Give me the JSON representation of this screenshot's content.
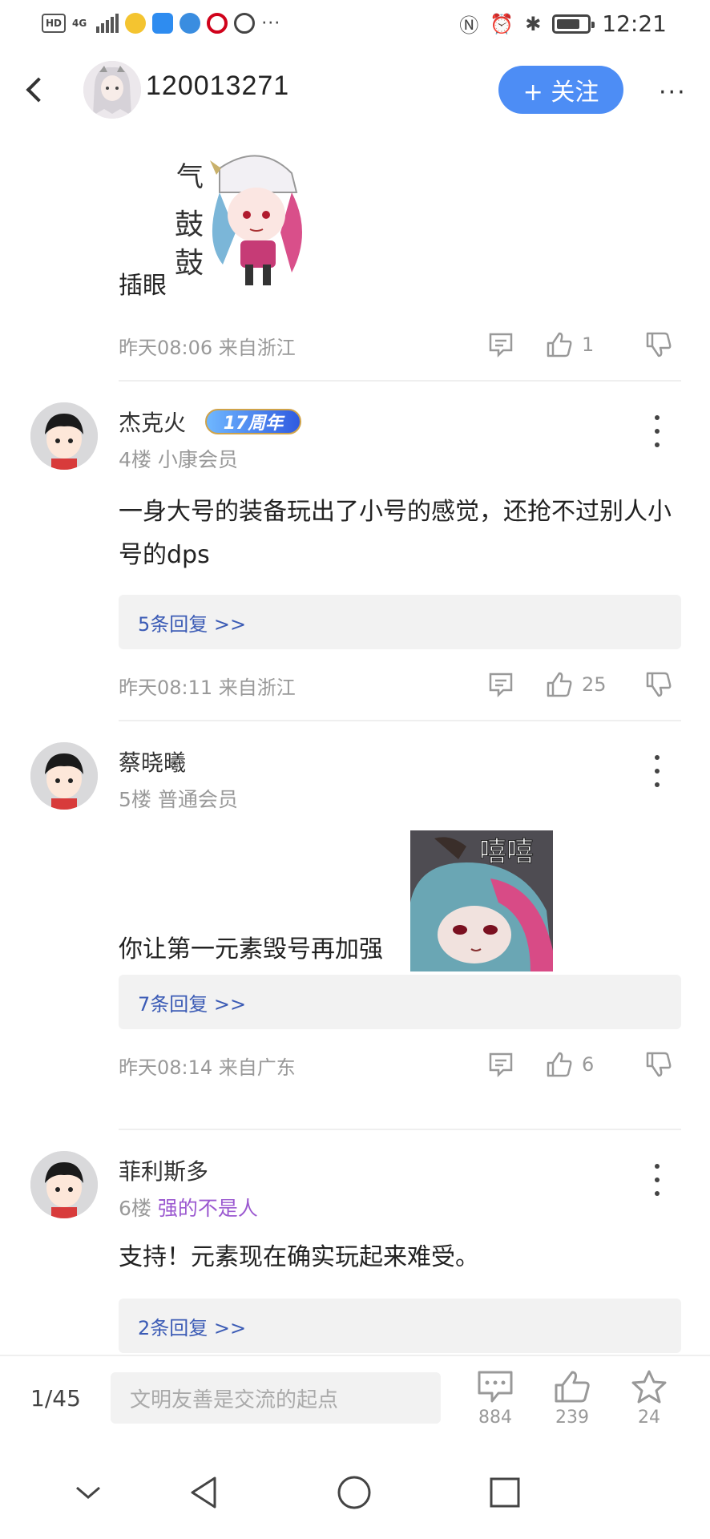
{
  "status_bar": {
    "time": "12:21",
    "hd_label": "HD",
    "network": "4G",
    "icons": [
      "weibo-icon",
      "app-icon",
      "browser-icon",
      "cmb-icon",
      "hand-icon",
      "more-icon",
      "nfc-icon",
      "alarm-icon",
      "bluetooth-icon",
      "battery-icon"
    ]
  },
  "header": {
    "title": "120013271",
    "follow_label": "+ 关注",
    "more_label": "···",
    "accent": "#4d8df5"
  },
  "feed": {
    "top_post": {
      "text": "插眼",
      "time": "昨天08:06 来自浙江",
      "likes": "1"
    },
    "comments": [
      {
        "username": "杰克火",
        "badge": "17周年",
        "meta_floor": "4楼",
        "meta_tag": "小康会员",
        "text": "一身大号的装备玩出了小号的感觉，还抢不过别人小号的dps",
        "replies": "5条回复 >>",
        "time": "昨天08:11 来自浙江",
        "likes": "25"
      },
      {
        "username": "蔡晓曦",
        "meta_floor": "5楼",
        "meta_tag": "普通会员",
        "text": "你让第一元素毁号再加强",
        "sticker_text": "嘻嘻",
        "replies": "7条回复 >>",
        "time": "昨天08:14 来自广东",
        "likes": "6"
      },
      {
        "username": "菲利斯多",
        "meta_floor": "6楼",
        "meta_tag": "强的不是人",
        "text": "支持！元素现在确实玩起来难受。",
        "replies": "2条回复 >>"
      }
    ]
  },
  "bottom_bar": {
    "page_indicator": "1/45",
    "comment_placeholder": "文明友善是交流的起点",
    "comments_count": "884",
    "likes_count": "239",
    "favorites_count": "24"
  }
}
